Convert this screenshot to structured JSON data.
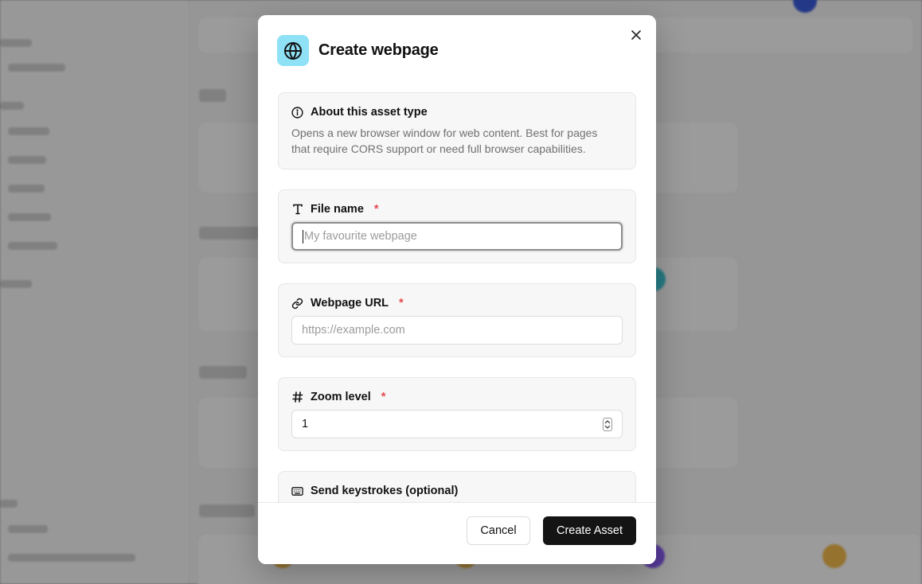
{
  "modal": {
    "title": "Create webpage",
    "header_icon": "globe-icon",
    "close_icon": "close-icon"
  },
  "about": {
    "icon": "info-icon",
    "heading": "About this asset type",
    "description": "Opens a new browser window for web content. Best for pages that require CORS support or need full browser capabilities."
  },
  "fields": {
    "file_name": {
      "icon": "text-icon",
      "label": "File name",
      "required_mark": "*",
      "placeholder": "My favourite webpage",
      "value": ""
    },
    "webpage_url": {
      "icon": "link-icon",
      "label": "Webpage URL",
      "required_mark": "*",
      "placeholder": "https://example.com",
      "value": ""
    },
    "zoom_level": {
      "icon": "hash-icon",
      "label": "Zoom level",
      "required_mark": "*",
      "value": "1"
    },
    "keystrokes": {
      "icon": "keyboard-icon",
      "label": "Send keystrokes (optional)"
    }
  },
  "footer": {
    "cancel_label": "Cancel",
    "create_label": "Create Asset"
  },
  "colors": {
    "accent_icon_bg": "#8fe1f5",
    "required": "#e5484d",
    "primary_button": "#141414"
  }
}
